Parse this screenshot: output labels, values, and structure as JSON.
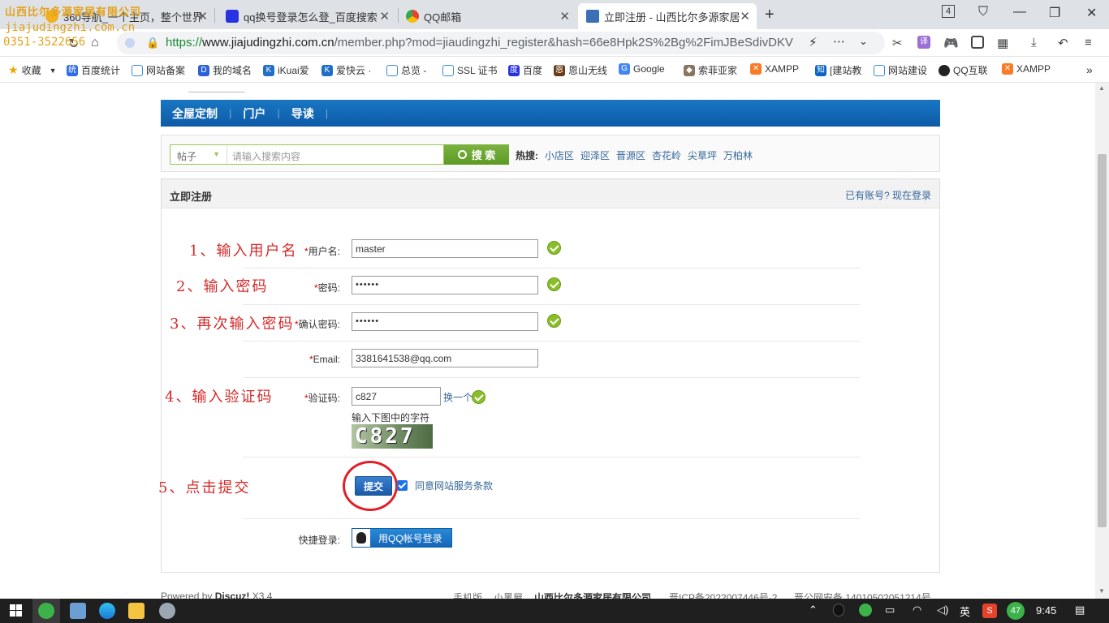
{
  "browser": {
    "watermark": {
      "company": "山西比尔多源家居有限公司",
      "site": "jiajudingzhi.com.cn",
      "phone": "0351-3522656"
    },
    "tabs": [
      {
        "title": "360导航_一个主页，整个世界"
      },
      {
        "title": "qq换号登录怎么登_百度搜索"
      },
      {
        "title": "QQ邮箱"
      },
      {
        "title": "立即注册 - 山西比尔多源家居"
      }
    ],
    "tab_count": "4",
    "url_scheme": "https://",
    "url_domain": "www.jiajudingzhi.com.cn",
    "url_path": "/member.php?mod=jiaudingzhi_register&hash=66e8Hpk2S%2Bg%2FimJBeSdivDKV",
    "bookmarks": [
      "收藏",
      "百度统计",
      "网站备案",
      "我的域名",
      "iKuai爱",
      "爱快云 ·",
      "总览 -",
      "SSL 证书",
      "百度",
      "恩山无线",
      "Google",
      "索菲亚家",
      "XAMPP",
      "[建站教",
      "网站建设",
      "QQ互联",
      "XAMPP"
    ]
  },
  "nav": {
    "items": [
      "全屋定制",
      "门户",
      "导读"
    ]
  },
  "search": {
    "type": "帖子",
    "placeholder": "请输入搜索内容",
    "button": "搜 索",
    "hot_label": "热搜:",
    "hot_links": [
      "小店区",
      "迎泽区",
      "晋源区",
      "杏花岭",
      "尖草坪",
      "万柏林"
    ]
  },
  "register": {
    "title": "立即注册",
    "login_link": "已有账号? 现在登录",
    "username_label": "用户名:",
    "username_value": "master",
    "password_label": "密码:",
    "password_value": "••••••",
    "confirm_label": "确认密码:",
    "confirm_value": "••••••",
    "email_label": "Email:",
    "email_value": "3381641538@qq.com",
    "captcha_label": "验证码:",
    "captcha_value": "c827",
    "captcha_change": "换一个",
    "captcha_hint": "输入下图中的字符",
    "captcha_image_text": "C827",
    "submit": "提交",
    "agree": "同意网站服务条款",
    "quick_login_label": "快捷登录:",
    "qq_login": "用QQ帐号登录",
    "required_mark": "*"
  },
  "annotations": {
    "step1": "1、输入用户名",
    "step2": "2、输入密码",
    "step3": "3、再次输入密码",
    "step4": "4、输入验证码",
    "step5": "5、点击提交"
  },
  "footer": {
    "powered": "Powered by",
    "brand": "Discuz!",
    "version": "X3.4",
    "links": [
      "手机版",
      "小黑屋",
      "山西比尔多源家居有限公司",
      "晋ICP备2022007446号-2",
      "晋公网安备 14010502051214号"
    ]
  },
  "taskbar": {
    "ime": "英",
    "badge": "47",
    "time": "9:45"
  },
  "colors": {
    "nav_blue": "#0d5ba8",
    "search_green": "#5c9a22",
    "annotation_red": "#d42a2a",
    "link_blue": "#336699"
  }
}
